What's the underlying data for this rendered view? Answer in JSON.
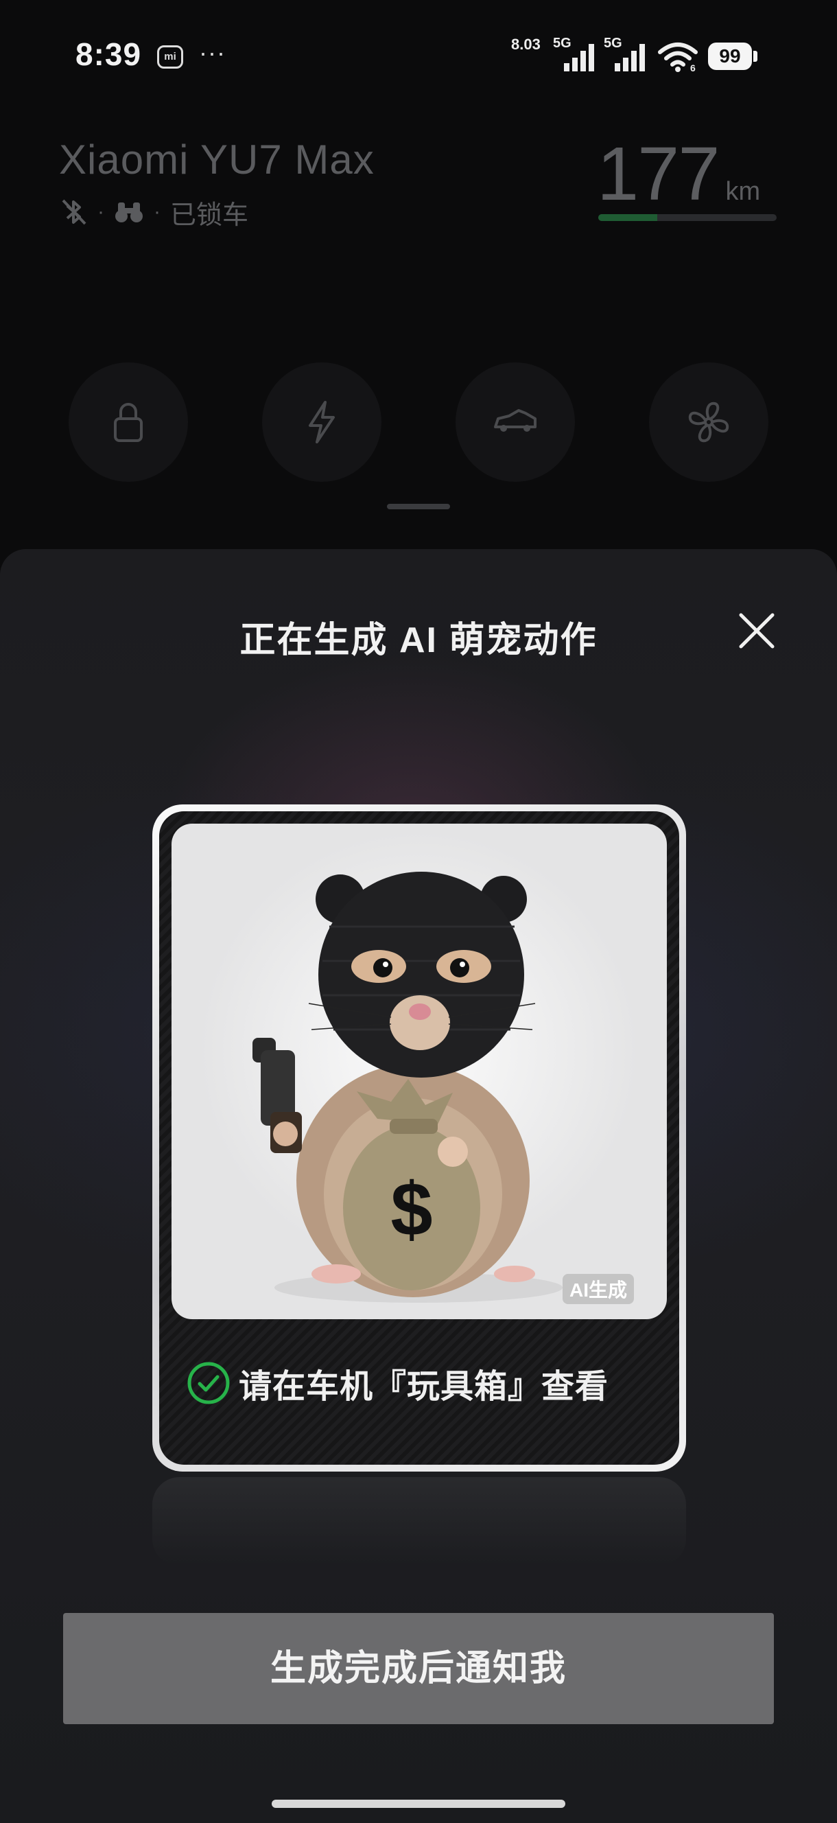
{
  "status_bar": {
    "time": "8:39",
    "mi_badge": "mi",
    "more": "···",
    "net_speed": "8.03",
    "sim1_label": "5G",
    "sim2_label": "5G",
    "battery": "99"
  },
  "car": {
    "name": "Xiaomi YU7 Max",
    "lock_status": "已锁车",
    "range_value": "177",
    "range_unit": "km",
    "range_fraction": 0.33,
    "controls": [
      "lock-icon",
      "charge-icon",
      "trunk-icon",
      "fan-icon"
    ]
  },
  "sheet": {
    "title": "正在生成 AI 萌宠动作",
    "ai_tag": "AI生成",
    "notice": "请在车机『玩具箱』查看",
    "notify_button": "生成完成后通知我"
  },
  "colors": {
    "accent_green": "#27b34a",
    "range_fill": "#1f5c33"
  }
}
